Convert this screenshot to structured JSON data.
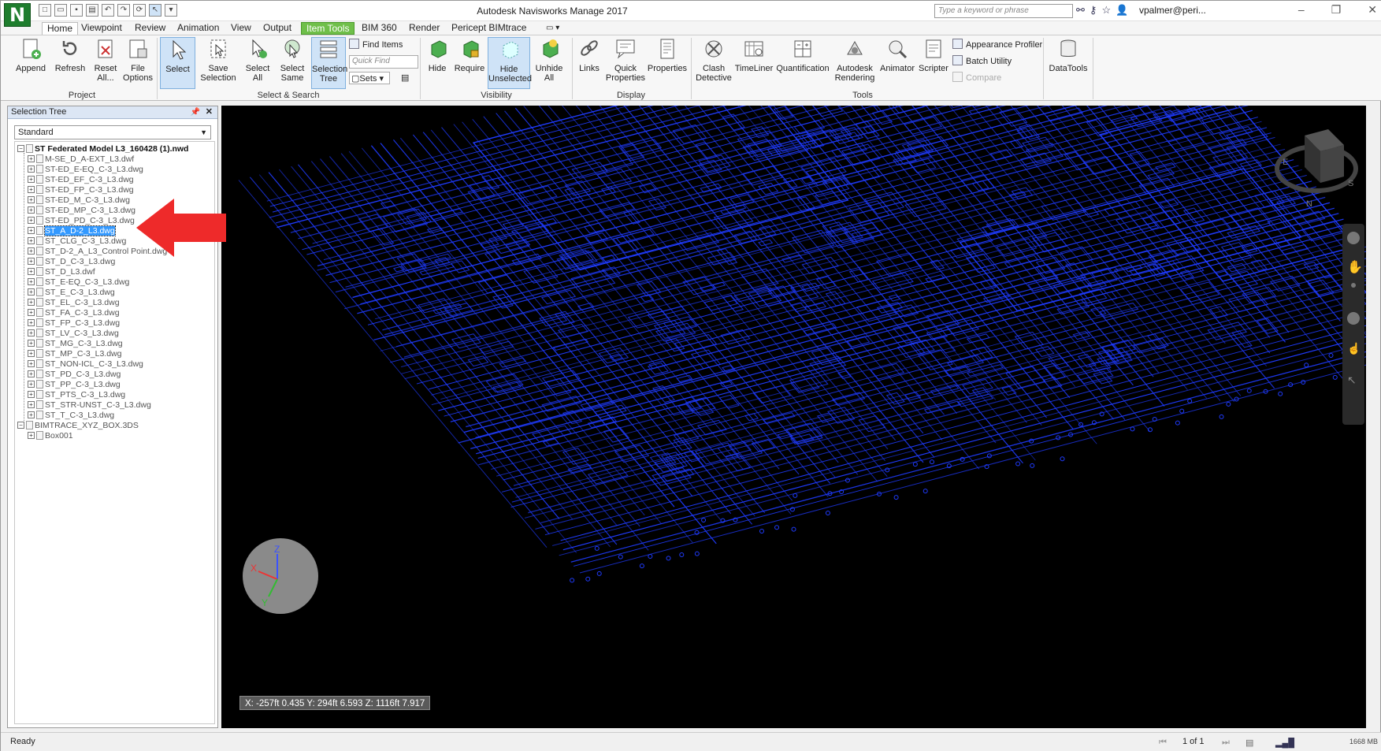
{
  "app": {
    "logo_letter": "N",
    "window_title": "Autodesk Navisworks Manage 2017",
    "search_placeholder": "Type a keyword or phrase",
    "user": "vpalmer@peri...",
    "help": "?"
  },
  "tabs": [
    "Home",
    "Viewpoint",
    "Review",
    "Animation",
    "View",
    "Output",
    "Item Tools",
    "BIM 360",
    "Render",
    "Pericept BIMtrace"
  ],
  "ribbon": {
    "project": {
      "label": "Project",
      "buttons": [
        "Append",
        "Refresh",
        "Reset All...",
        "File Options"
      ]
    },
    "select_search": {
      "label": "Select & Search",
      "buttons": [
        "Select",
        "Save Selection",
        "Select All",
        "Select Same",
        "Selection Tree"
      ],
      "find_items": "Find Items",
      "quick_find_placeholder": "Quick Find",
      "sets": "Sets"
    },
    "visibility": {
      "label": "Visibility",
      "buttons": [
        "Hide",
        "Require",
        "Hide Unselected",
        "Unhide All"
      ]
    },
    "display": {
      "label": "Display",
      "buttons": [
        "Links",
        "Quick Properties",
        "Properties"
      ]
    },
    "tools": {
      "label": "Tools",
      "buttons": [
        "Clash Detective",
        "TimeLiner",
        "Quantification",
        "Autodesk Rendering",
        "Animator",
        "Scripter"
      ],
      "small": [
        "Appearance Profiler",
        "Batch Utility",
        "Compare"
      ]
    },
    "datatools": {
      "buttons": [
        "DataTools"
      ]
    }
  },
  "selection_tree": {
    "title": "Selection Tree",
    "dropdown_value": "Standard",
    "root": "ST Federated Model L3_160428 (1).nwd",
    "items": [
      "M-SE_D_A-EXT_L3.dwf",
      "ST-ED_E-EQ_C-3_L3.dwg",
      "ST-ED_EF_C-3_L3.dwg",
      "ST-ED_FP_C-3_L3.dwg",
      "ST-ED_M_C-3_L3.dwg",
      "ST-ED_MP_C-3_L3.dwg",
      "ST-ED_PD_C-3_L3.dwg",
      "ST_A_D-2_L3.dwg",
      "ST_CLG_C-3_L3.dwg",
      "ST_D-2_A_L3_Control Point.dwg",
      "ST_D_C-3_L3.dwg",
      "ST_D_L3.dwf",
      "ST_E-EQ_C-3_L3.dwg",
      "ST_E_C-3_L3.dwg",
      "ST_EL_C-3_L3.dwg",
      "ST_FA_C-3_L3.dwg",
      "ST_FP_C-3_L3.dwg",
      "ST_LV_C-3_L3.dwg",
      "ST_MG_C-3_L3.dwg",
      "ST_MP_C-3_L3.dwg",
      "ST_NON-ICL_C-3_L3.dwg",
      "ST_PD_C-3_L3.dwg",
      "ST_PP_C-3_L3.dwg",
      "ST_PTS_C-3_L3.dwg",
      "ST_STR-UNST_C-3_L3.dwg",
      "ST_T_C-3_L3.dwg"
    ],
    "selected_item": "ST_A_D-2_L3.dwg",
    "second_root": "BIMTRACE_XYZ_BOX.3DS",
    "second_child": "Box001"
  },
  "viewport": {
    "coordinates": "X: -257ft 0.435  Y: 294ft 6.593  Z: 1116ft 7.917",
    "axis_labels": [
      "X",
      "Y",
      "Z"
    ],
    "viewcube_labels": [
      "N",
      "E",
      "S"
    ],
    "wire_color": "#1f3bff"
  },
  "status": {
    "text": "Ready",
    "page": "1 of 1",
    "memory": "1668 MB"
  }
}
